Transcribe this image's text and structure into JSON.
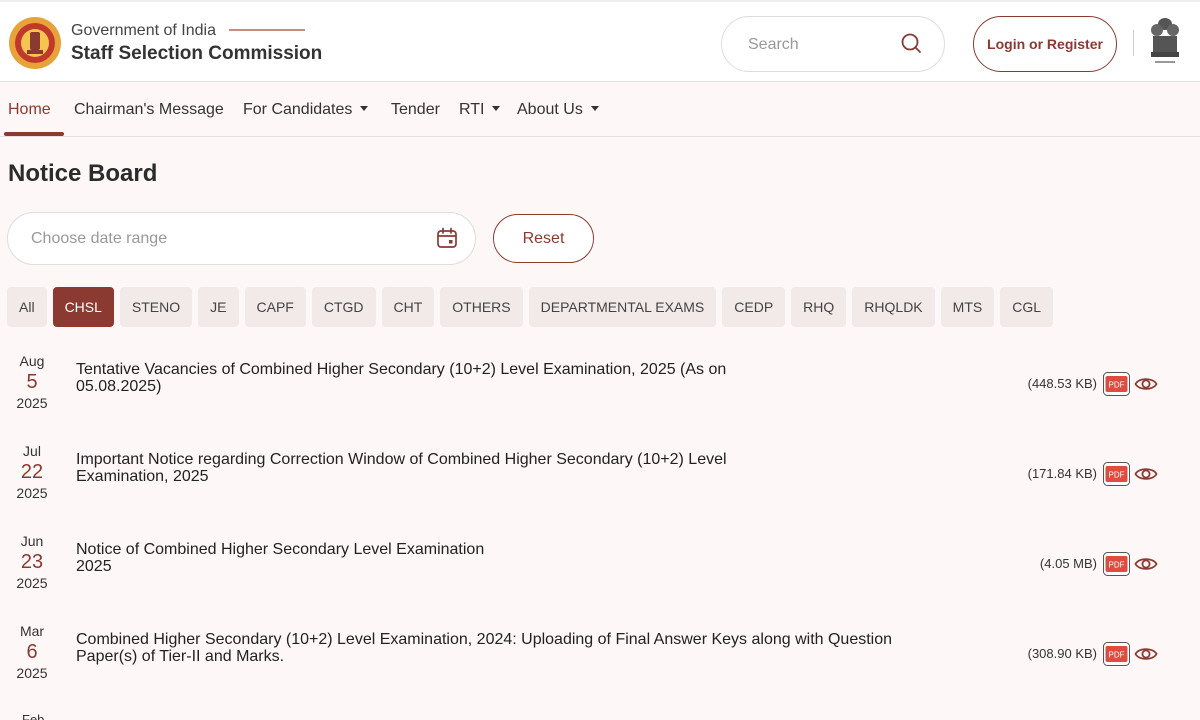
{
  "header": {
    "org_line": "Government of India",
    "org_name": "Staff Selection Commission",
    "search_placeholder": "Search",
    "login_label": "Login or Register",
    "icons": {
      "logo": "ssc-logo-icon",
      "search": "search-icon",
      "emblem": "national-emblem-icon"
    }
  },
  "nav": {
    "items": [
      {
        "label": "Home",
        "active": true
      },
      {
        "label": "Chairman's Message"
      },
      {
        "label": "For Candidates",
        "dropdown": true
      },
      {
        "label": "Tender"
      },
      {
        "label": "RTI",
        "dropdown": true
      },
      {
        "label": "About Us",
        "dropdown": true
      }
    ]
  },
  "main": {
    "title": "Notice Board",
    "date_placeholder": "Choose date range",
    "reset_label": "Reset",
    "tabs": [
      "All",
      "CHSL",
      "STENO",
      "JE",
      "CAPF",
      "CTGD",
      "CHT",
      "OTHERS",
      "DEPARTMENTAL EXAMS",
      "CEDP",
      "RHQ",
      "RHQLDK",
      "MTS",
      "CGL"
    ],
    "active_tab": "CHSL",
    "notices": [
      {
        "month": "Aug",
        "day": "5",
        "year": "2025",
        "title_l1": "Tentative Vacancies of Combined Higher Secondary (10+2) Level Examination, 2025 (As on",
        "title_l2": "05.08.2025)",
        "size": "(448.53 KB)"
      },
      {
        "month": "Jul",
        "day": "22",
        "year": "2025",
        "title_l1": "Important Notice regarding Correction Window of Combined Higher Secondary (10+2) Level",
        "title_l2": "Examination, 2025",
        "size": "(171.84 KB)"
      },
      {
        "month": "Jun",
        "day": "23",
        "year": "2025",
        "title_l1": "Notice of Combined Higher Secondary Level Examination",
        "title_l2": "2025",
        "size": "(4.05 MB)"
      },
      {
        "month": "Mar",
        "day": "6",
        "year": "2025",
        "title_l1": "Combined Higher Secondary (10+2) Level Examination, 2024: Uploading of Final Answer Keys along with Question",
        "title_l2": "Paper(s) of Tier-II and Marks.",
        "size": "(308.90 KB)"
      }
    ],
    "pdf_label": "PDF",
    "next_month_peek": "Feb"
  },
  "colors": {
    "accent": "#8b3a32",
    "pdf_red": "#e04b3f",
    "background": "#fdf8f7"
  }
}
